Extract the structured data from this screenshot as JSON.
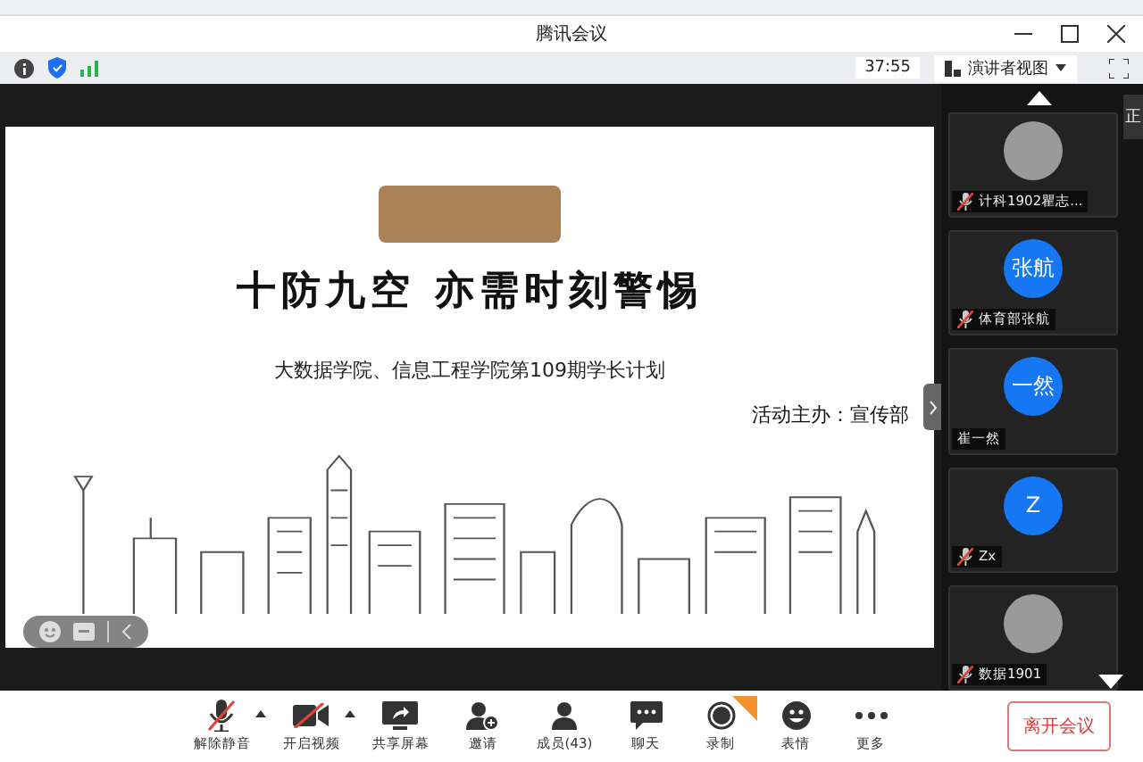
{
  "window": {
    "title": "腾讯会议"
  },
  "info_bar": {
    "timer": "37:55",
    "view_button": "演讲者视图"
  },
  "slide": {
    "title": "十防九空 亦需时刻警惕",
    "subtitle": "大数据学院、信息工程学院第109期学长计划",
    "organizer": "活动主办：宣传部"
  },
  "side_tab": "正",
  "participants": [
    {
      "name": "计科1902瞿志...",
      "kind": "photo",
      "muted": true
    },
    {
      "name": "体育部张航",
      "kind": "initials",
      "initials": "张航",
      "muted": true
    },
    {
      "name": "崔一然",
      "kind": "initials",
      "initials": "一然",
      "muted": false
    },
    {
      "name": "Zx",
      "kind": "initials",
      "initials": "Z",
      "muted": true
    },
    {
      "name": "数据1901",
      "kind": "photo",
      "muted": true
    }
  ],
  "toolbar": [
    {
      "label": "解除静音",
      "menu": true,
      "badge": false
    },
    {
      "label": "开启视频",
      "menu": true,
      "badge": false
    },
    {
      "label": "共享屏幕",
      "menu": false,
      "badge": false
    },
    {
      "label": "邀请",
      "menu": false,
      "badge": false
    },
    {
      "label": "成员(43)",
      "menu": false,
      "badge": false
    },
    {
      "label": "聊天",
      "menu": false,
      "badge": false
    },
    {
      "label": "录制",
      "menu": false,
      "badge": true
    },
    {
      "label": "表情",
      "menu": false,
      "badge": false
    },
    {
      "label": "更多",
      "menu": false,
      "badge": false
    }
  ],
  "leave_button": "离开会议"
}
